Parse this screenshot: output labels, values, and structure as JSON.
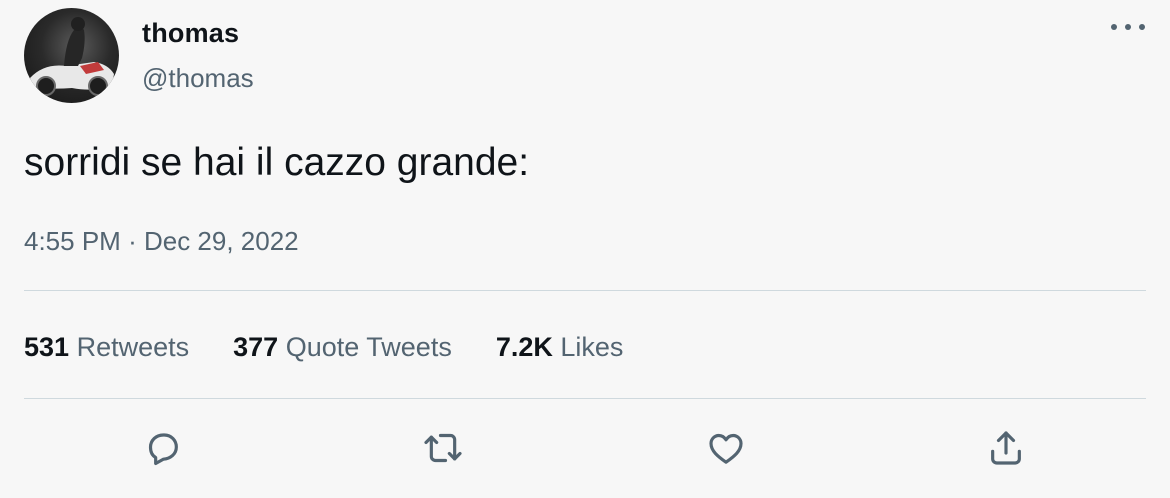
{
  "user": {
    "display_name": "thomas",
    "handle": "@thomas"
  },
  "tweet": {
    "text": "sorridi se hai il cazzo grande:",
    "time": "4:55 PM",
    "separator": "·",
    "date": "Dec 29, 2022"
  },
  "stats": [
    {
      "count": "531",
      "label": "Retweets"
    },
    {
      "count": "377",
      "label": "Quote Tweets"
    },
    {
      "count": "7.2K",
      "label": "Likes"
    }
  ],
  "actions": {
    "reply_icon": "reply-icon",
    "retweet_icon": "retweet-icon",
    "like_icon": "heart-icon",
    "share_icon": "share-icon"
  },
  "colors": {
    "primary_text": "#0f1419",
    "secondary_text": "#536471",
    "divider": "#cfd9de",
    "background": "#f7f7f7"
  }
}
